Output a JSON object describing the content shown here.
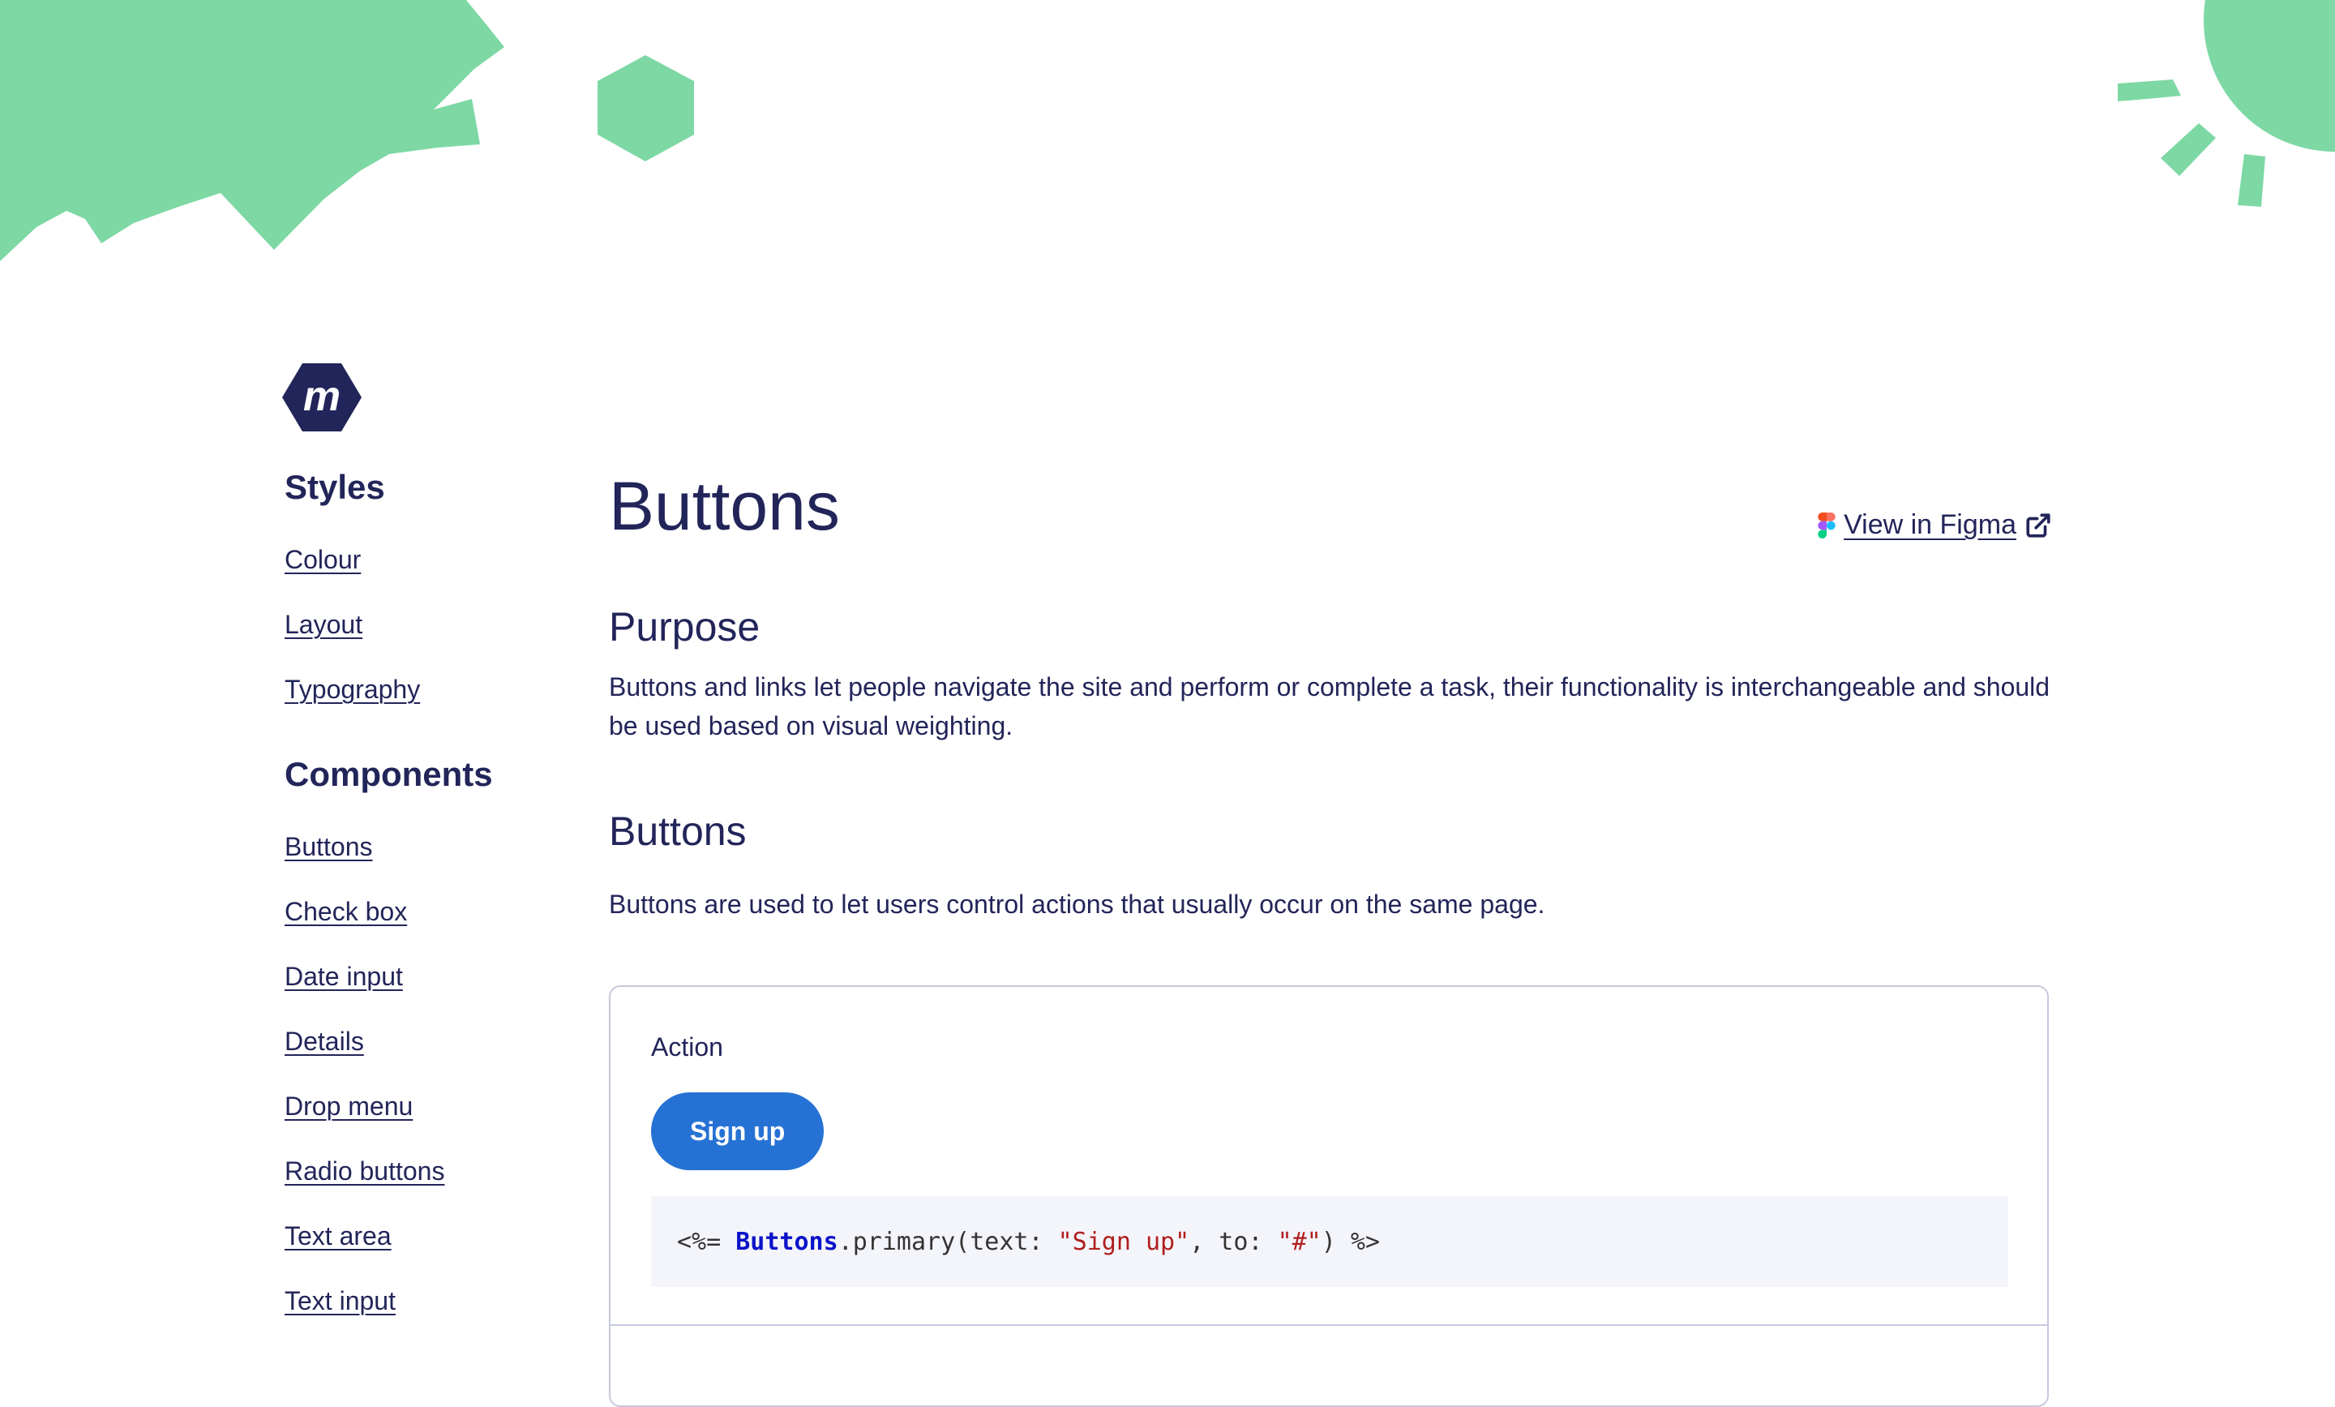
{
  "brand": {
    "logo_text": "m",
    "primary_color": "#222559",
    "accent_green": "#7dd8a4",
    "button_blue": "#2672d4"
  },
  "sidebar": {
    "styles_title": "Styles",
    "styles_items": [
      {
        "label": "Colour"
      },
      {
        "label": "Layout"
      },
      {
        "label": "Typography"
      }
    ],
    "components_title": "Components",
    "components_items": [
      {
        "label": "Buttons"
      },
      {
        "label": "Check box"
      },
      {
        "label": "Date input"
      },
      {
        "label": "Details"
      },
      {
        "label": "Drop menu"
      },
      {
        "label": "Radio buttons"
      },
      {
        "label": "Text area"
      },
      {
        "label": "Text input"
      }
    ]
  },
  "main": {
    "page_title": "Buttons",
    "figma_link": "View in Figma",
    "purpose_heading": "Purpose",
    "purpose_text": "Buttons and links let people navigate the site and perform or complete a task, their functionality is interchangeable and should be used based on visual weighting.",
    "buttons_heading": "Buttons",
    "buttons_text": "Buttons are used to let users control actions that usually occur on the same page.",
    "example": {
      "label": "Action",
      "button_label": "Sign up",
      "code": {
        "prefix": "<%= ",
        "class_name": "Buttons",
        "method": ".primary(text: ",
        "text_value": "\"Sign up\"",
        "middle": ", to: ",
        "to_value": "\"#\"",
        "suffix": ") %>"
      }
    }
  }
}
